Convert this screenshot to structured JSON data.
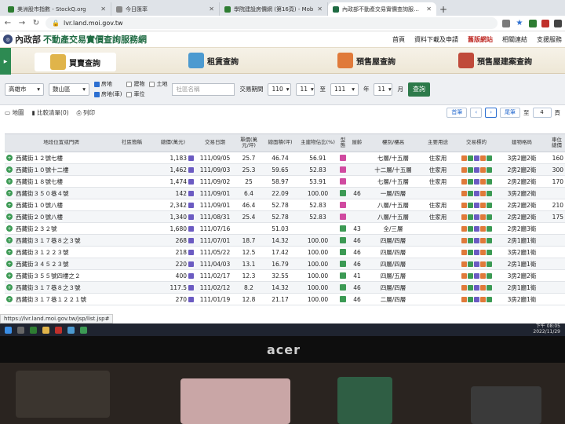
{
  "browser": {
    "tabs": [
      {
        "title": "美洲股市指數 - StockQ.org",
        "color": "#2e7d32",
        "active": false
      },
      {
        "title": "今日匯率",
        "color": "#888888",
        "active": false
      },
      {
        "title": "學院建設房價網 (第16頁) - Mob",
        "color": "#2e7d32",
        "active": false
      },
      {
        "title": "內政部不動產交易實價查詢服務網",
        "color": "#1f6b43",
        "active": true
      }
    ],
    "url": "lvr.land.moi.gov.tw",
    "status_url": "https://lvr.land.moi.gov.tw/jsp/list.jsp#"
  },
  "site": {
    "logo_prefix": "內政部",
    "logo_title": "不動產交易實價查詢服務網",
    "nav": [
      "首頁",
      "資料下載及申請",
      "舊版網站",
      "相關連結",
      "支援服務"
    ],
    "banner": [
      "買賣查詢",
      "租賃查詢",
      "預售屋查詢",
      "預售屋建案查詢"
    ]
  },
  "search": {
    "city": "高雄市",
    "district": "鼓山區",
    "types": [
      "房地",
      "建物",
      "土地",
      "房地(車)",
      "車位"
    ],
    "name_placeholder": "社區名稱",
    "period_label": "交易期間",
    "from_year": "110",
    "from_month": "11",
    "to_label": "至",
    "to_year": "111",
    "to_month": "11",
    "year_label": "年",
    "month_label": "月",
    "submit": "查詢"
  },
  "toolbar": {
    "map": "地圖",
    "compare": "比較清單(0)",
    "print": "列印",
    "first": "首筆",
    "last": "尾筆",
    "page": "4",
    "page_suffix": "頁"
  },
  "table": {
    "headers": [
      "地段位置或門牌",
      "社區簡稱",
      "總價(萬元)",
      "交易日期",
      "單價(萬元/坪)",
      "總面積(坪)",
      "主建物佔比(%)",
      "型態",
      "屋齡",
      "樓別/樓高",
      "主要用途",
      "交易標的",
      "建物格局",
      "車位總價"
    ],
    "rows": [
      {
        "addr": "西藏街１２號七樓",
        "total": "1,183",
        "date": "111/09/05",
        "unit": "25.7",
        "area": "46.74",
        "ratio": "56.91",
        "age": "",
        "floor": "七層/十五層",
        "use": "住家用",
        "layout": "3房2廳2衛",
        "park": "160"
      },
      {
        "addr": "西藏街１０號十二樓",
        "total": "1,462",
        "date": "111/09/03",
        "unit": "25.3",
        "area": "59.65",
        "ratio": "52.83",
        "age": "",
        "floor": "十二層/十五層",
        "use": "住家用",
        "layout": "2房2廳2衛",
        "park": "300"
      },
      {
        "addr": "西藏街１８號七樓",
        "total": "1,474",
        "date": "111/09/02",
        "unit": "25",
        "area": "58.97",
        "ratio": "53.91",
        "age": "",
        "floor": "七層/十五層",
        "use": "住家用",
        "layout": "2房2廳2衛",
        "park": "170"
      },
      {
        "addr": "西藏街３５０巷４號",
        "total": "142",
        "date": "111/09/01",
        "unit": "6.4",
        "area": "22.09",
        "ratio": "100.00",
        "age": "46",
        "floor": "一層/四層",
        "use": "",
        "layout": "3房2廳2衛",
        "park": ""
      },
      {
        "addr": "西藏街１０號八樓",
        "total": "2,342",
        "date": "111/09/01",
        "unit": "46.4",
        "area": "52.78",
        "ratio": "52.83",
        "age": "",
        "floor": "八層/十五層",
        "use": "住家用",
        "layout": "2房2廳2衛",
        "park": "210"
      },
      {
        "addr": "西藏街２０號八樓",
        "total": "1,340",
        "date": "111/08/31",
        "unit": "25.4",
        "area": "52.78",
        "ratio": "52.83",
        "age": "",
        "floor": "八層/十五層",
        "use": "住家用",
        "layout": "2房2廳2衛",
        "park": "175"
      },
      {
        "addr": "西藏街２３２號",
        "total": "1,680",
        "date": "111/07/16",
        "unit": "",
        "area": "51.03",
        "ratio": "",
        "age": "43",
        "floor": "全/三層",
        "use": "",
        "layout": "2房2廳3衛",
        "park": ""
      },
      {
        "addr": "西藏街３１７巷８之３號",
        "total": "268",
        "date": "111/07/01",
        "unit": "18.7",
        "area": "14.32",
        "ratio": "100.00",
        "age": "46",
        "floor": "四層/四層",
        "use": "",
        "layout": "2房1廳1衛",
        "park": ""
      },
      {
        "addr": "西藏街３１２２３號",
        "total": "218",
        "date": "111/05/22",
        "unit": "12.5",
        "area": "17.42",
        "ratio": "100.00",
        "age": "46",
        "floor": "四層/四層",
        "use": "",
        "layout": "3房2廳1衛",
        "park": ""
      },
      {
        "addr": "西藏街３４５２３號",
        "total": "220",
        "date": "111/04/03",
        "unit": "13.1",
        "area": "16.79",
        "ratio": "100.00",
        "age": "46",
        "floor": "四層/四層",
        "use": "",
        "layout": "2房1廳1衛",
        "park": ""
      },
      {
        "addr": "西藏街３５５號四樓之２",
        "total": "400",
        "date": "111/02/17",
        "unit": "12.3",
        "area": "32.55",
        "ratio": "100.00",
        "age": "41",
        "floor": "四層/五層",
        "use": "",
        "layout": "3房2廳2衛",
        "park": ""
      },
      {
        "addr": "西藏街３１７巷８之３號",
        "total": "117.5",
        "date": "111/02/12",
        "unit": "8.2",
        "area": "14.32",
        "ratio": "100.00",
        "age": "46",
        "floor": "四層/四層",
        "use": "",
        "layout": "2房1廳1衛",
        "park": ""
      },
      {
        "addr": "西藏街３１７巷１２２１號",
        "total": "270",
        "date": "111/01/19",
        "unit": "12.8",
        "area": "21.17",
        "ratio": "100.00",
        "age": "46",
        "floor": "二層/四層",
        "use": "",
        "layout": "3房2廳1衛",
        "park": ""
      }
    ]
  },
  "monitor": {
    "brand": "acer",
    "clock_time": "下午 08:05",
    "clock_date": "2022/11/29"
  }
}
